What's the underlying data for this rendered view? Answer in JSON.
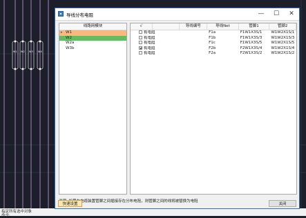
{
  "cad": {
    "status_lines": [
      "指定所有选中对象",
      "命令: _......"
    ],
    "device_labels": [
      "W1",
      "W2",
      "W3",
      "W4"
    ]
  },
  "dialog": {
    "title": "导线分布电阻",
    "buttons": {
      "minimize": "—",
      "maximize": "☐",
      "close": "✕"
    },
    "left_panel": {
      "header": "线路网模块",
      "items": [
        {
          "label": "W1",
          "highlight": "#f8b97f",
          "expander": "▸"
        },
        {
          "label": "W2",
          "highlight": "#5fbf5f",
          "expander": ""
        },
        {
          "label": "W2a",
          "highlight": "",
          "expander": ""
        },
        {
          "label": "W3b",
          "highlight": "",
          "expander": ""
        }
      ]
    },
    "table": {
      "columns": [
        "√",
        "导线编号",
        "导线Net",
        "管脚1",
        "管脚2"
      ],
      "rows": [
        {
          "checked": false,
          "name": "有电阻",
          "wire_no": "",
          "net": "F1a",
          "pin1": "F1W1X3S/1",
          "pin2": "W1W2X1S/1"
        },
        {
          "checked": false,
          "name": "有电阻",
          "wire_no": "",
          "net": "F1b",
          "pin1": "F1W1X3S/3",
          "pin2": "W1W2X1S/3"
        },
        {
          "checked": false,
          "name": "有电阻",
          "wire_no": "",
          "net": "F1c",
          "pin1": "F1W1X3S/5",
          "pin2": "W1W2X1S/5"
        },
        {
          "checked": true,
          "name": "有电阻",
          "wire_no": "",
          "net": "F2b",
          "pin1": "F2W1X3S/4",
          "pin2": "W1W2X1S/4"
        },
        {
          "checked": false,
          "name": "有电阻",
          "wire_no": "",
          "net": "F2a",
          "pin1": "F2W1X3S/2",
          "pin2": "W1W2X1S/2"
        }
      ]
    },
    "note": "说明: 如果布电缆装置管脚之间插接存在分布电阻，则管脚之间的线将被替换为电阻",
    "quick_button": "快速设置",
    "close_button": "关闭"
  }
}
